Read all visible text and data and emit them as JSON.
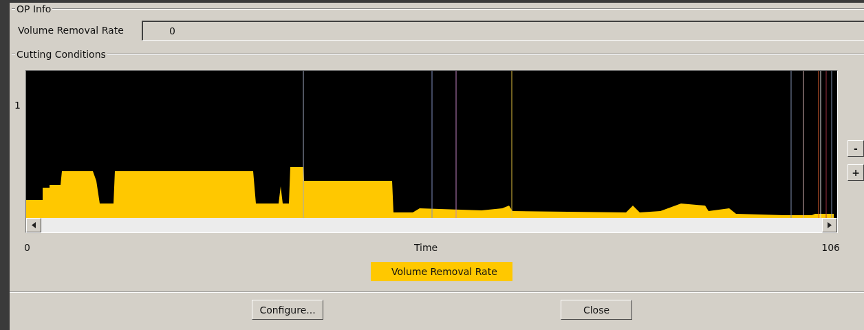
{
  "op_info": {
    "title": "OP Info",
    "fields": [
      {
        "label": "Volume Removal Rate",
        "value": "0"
      }
    ]
  },
  "cutting_conditions": {
    "title": "Cutting Conditions",
    "y_tick": "1",
    "x_ticks": [
      "0",
      "106"
    ],
    "xlabel": "Time",
    "legend": [
      {
        "label": "Volume Removal Rate",
        "color": "#ffc800"
      }
    ],
    "zoom_buttons": [
      "-",
      "+"
    ]
  },
  "buttons": [
    "Configure...",
    "Close"
  ]
}
